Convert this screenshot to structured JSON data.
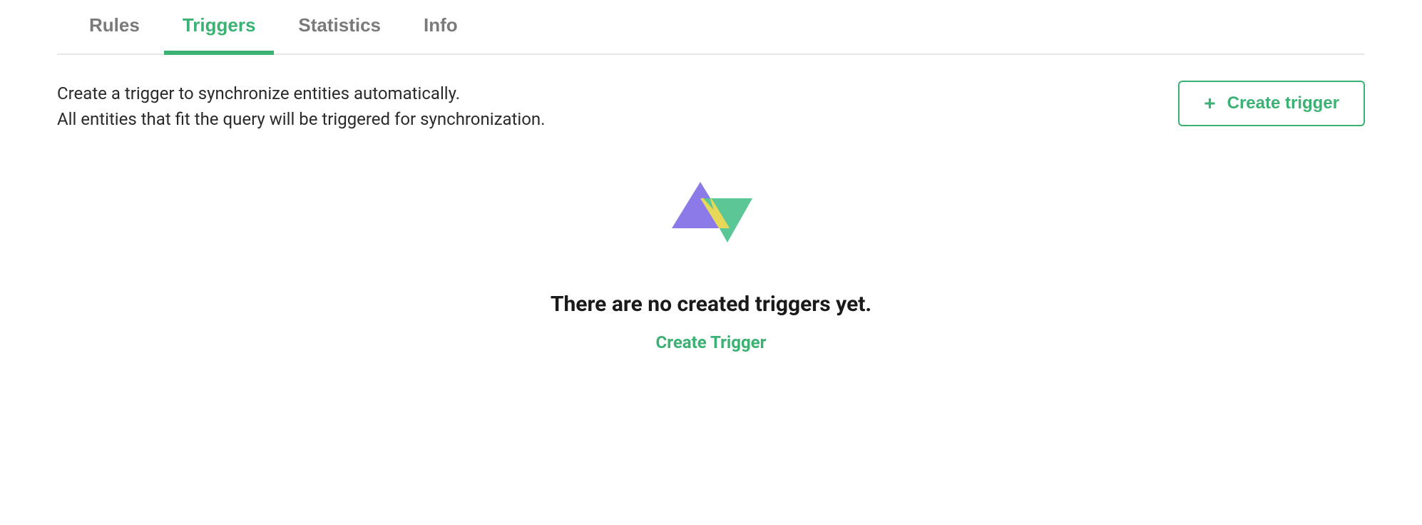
{
  "tabs": [
    {
      "label": "Rules",
      "active": false
    },
    {
      "label": "Triggers",
      "active": true
    },
    {
      "label": "Statistics",
      "active": false
    },
    {
      "label": "Info",
      "active": false
    }
  ],
  "description": {
    "line1": "Create a trigger to synchronize entities automatically.",
    "line2": "All entities that fit the query will be triggered for synchronization."
  },
  "createButton": {
    "label": "Create trigger"
  },
  "emptyState": {
    "title": "There are no created triggers yet.",
    "linkLabel": "Create Trigger"
  },
  "colors": {
    "accent": "#3bb273",
    "iconPurple": "#8b7ae8",
    "iconGreen": "#5bc696",
    "iconYellow": "#e8d858"
  }
}
